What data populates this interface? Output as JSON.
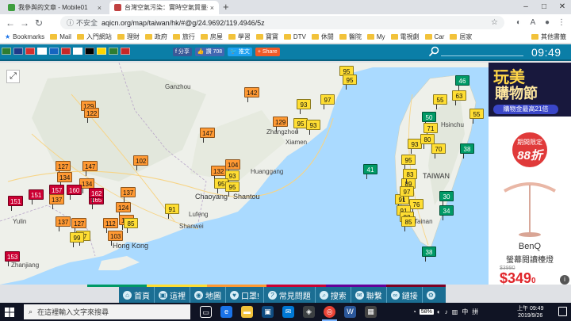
{
  "browser": {
    "tabs": [
      {
        "title": "我參與的文章 - Mobile01",
        "favicon_color": "#3e9e3e",
        "active": false
      },
      {
        "title": "台灣空氣污染：實時空氣質量指數",
        "favicon_color": "#c14141",
        "active": true
      }
    ],
    "new_tab": "+",
    "security": "不安全",
    "url": "aqicn.org/map/taiwan/hk/#@g/24.9692/119.4946/5z",
    "bookmarks_label": "Bookmarks",
    "bookmarks": [
      "Mail",
      "入門網站",
      "理財",
      "政府",
      "旅行",
      "房屋",
      "學習",
      "寶寶",
      "DTV",
      "休閒",
      "醫院",
      "My",
      "電視劇",
      "Car",
      "居家"
    ],
    "other_bookmarks": "其他書籤"
  },
  "site": {
    "flags": [
      "#2e7d32",
      "#1e3a8a",
      "#d32f2f",
      "#ffffff",
      "#1565c0",
      "#c62828",
      "#ffffff",
      "#000000",
      "#ffd600",
      "#2e7d32",
      "#c62828"
    ],
    "share_fb": "分享",
    "like": "讚 708",
    "tweet": "推文",
    "share": "Share",
    "clock": "09:49"
  },
  "map": {
    "labels": [
      {
        "text": "Ganzhou",
        "big": false
      },
      {
        "text": "Zhangzhou",
        "big": false
      },
      {
        "text": "Xiamen",
        "big": false
      },
      {
        "text": "Huanggang",
        "big": false
      },
      {
        "text": "Chaoyang",
        "big": true
      },
      {
        "text": "Shantou",
        "big": true
      },
      {
        "text": "Lufeng",
        "big": false
      },
      {
        "text": "Shanwei",
        "big": false
      },
      {
        "text": "Yulin",
        "big": false
      },
      {
        "text": "Hong Kong",
        "big": true
      },
      {
        "text": "Zhanjiang",
        "big": false
      },
      {
        "text": "Hsinchu",
        "big": false
      },
      {
        "text": "TAIWAN",
        "big": true
      },
      {
        "text": "Tainan",
        "big": false
      }
    ],
    "markers": [
      "95",
      "95",
      "142",
      "93",
      "97",
      "129",
      "122",
      "147",
      "129",
      "95",
      "93",
      "102",
      "127",
      "147",
      "134",
      "104",
      "132",
      "93",
      "95",
      "95",
      "137",
      "134",
      "151",
      "151",
      "157",
      "160",
      "165",
      "162",
      "137",
      "124",
      "91",
      "137",
      "127",
      "127",
      "97",
      "112",
      "85",
      "99",
      "103",
      "153",
      "41",
      "46",
      "55",
      "63",
      "55",
      "50",
      "71",
      "70",
      "95",
      "93",
      "80",
      "89",
      "91",
      "76",
      "38",
      "91",
      "82",
      "85",
      "30",
      "34",
      "38",
      "97",
      "83"
    ]
  },
  "ad": {
    "title1": "玩美",
    "title2": "購物節",
    "sub": "購物金最高21倍",
    "promo1": "期間限定",
    "promo2": "88折",
    "brand": "BenQ",
    "product": "螢幕閱讀檯燈",
    "old_price": "$3990",
    "price_main": "$349",
    "price_tail": "0",
    "info": "i"
  },
  "nav": [
    {
      "label": "首頁",
      "icon": "⌂"
    },
    {
      "label": "這裡",
      "icon": "▣"
    },
    {
      "label": "地圖",
      "icon": "◉"
    },
    {
      "label": "口罩!",
      "icon": "♥"
    },
    {
      "label": "常見問題",
      "icon": "?"
    },
    {
      "label": "搜索",
      "icon": "⌕"
    },
    {
      "label": "聯繫",
      "icon": "✉"
    },
    {
      "label": "鏈接",
      "icon": "∞"
    }
  ],
  "nav_colors": [
    "#009966",
    "#ffde33",
    "#ff9933",
    "#cc0033",
    "#660099",
    "#7e0023"
  ],
  "taskbar": {
    "search_placeholder": "在這裡輸入文字來搜尋",
    "battery": "58%",
    "time": "上午 09:49",
    "date": "2019/9/26"
  }
}
